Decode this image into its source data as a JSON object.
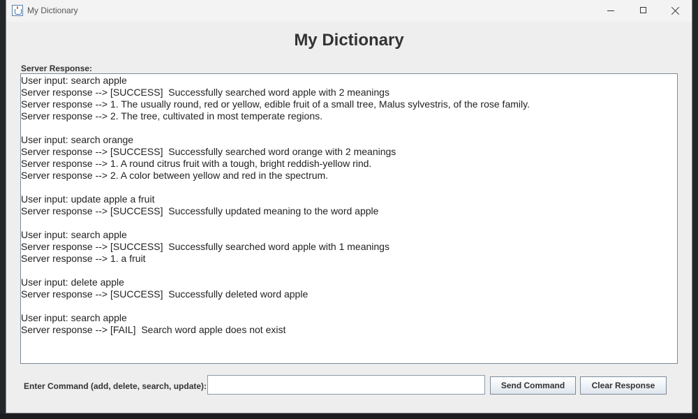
{
  "window": {
    "title": "My Dictionary"
  },
  "main": {
    "heading": "My Dictionary",
    "response_label": "Server Response:",
    "response_lines": [
      "User input: search apple",
      "Server response --> [SUCCESS]  Successfully searched word apple with 2 meanings",
      "Server response --> 1. The usually round, red or yellow, edible fruit of a small tree, Malus sylvestris, of the rose family.",
      "Server response --> 2. The tree, cultivated in most temperate regions.",
      "",
      "User input: search orange",
      "Server response --> [SUCCESS]  Successfully searched word orange with 2 meanings",
      "Server response --> 1. A round citrus fruit with a tough, bright reddish-yellow rind.",
      "Server response --> 2. A color between yellow and red in the spectrum.",
      "",
      "User input: update apple a fruit",
      "Server response --> [SUCCESS]  Successfully updated meaning to the word apple",
      "",
      "User input: search apple",
      "Server response --> [SUCCESS]  Successfully searched word apple with 1 meanings",
      "Server response --> 1. a fruit",
      "",
      "User input: delete apple",
      "Server response --> [SUCCESS]  Successfully deleted word apple",
      "",
      "User input: search apple",
      "Server response --> [FAIL]  Search word apple does not exist"
    ]
  },
  "command": {
    "label": "Enter Command (add, delete, search, update):",
    "value": "",
    "placeholder": "",
    "send_label": "Send Command",
    "clear_label": "Clear Response"
  },
  "icons": {
    "app": "java-cup-icon",
    "minimize": "minimize-icon",
    "maximize": "maximize-icon",
    "close": "close-icon"
  }
}
